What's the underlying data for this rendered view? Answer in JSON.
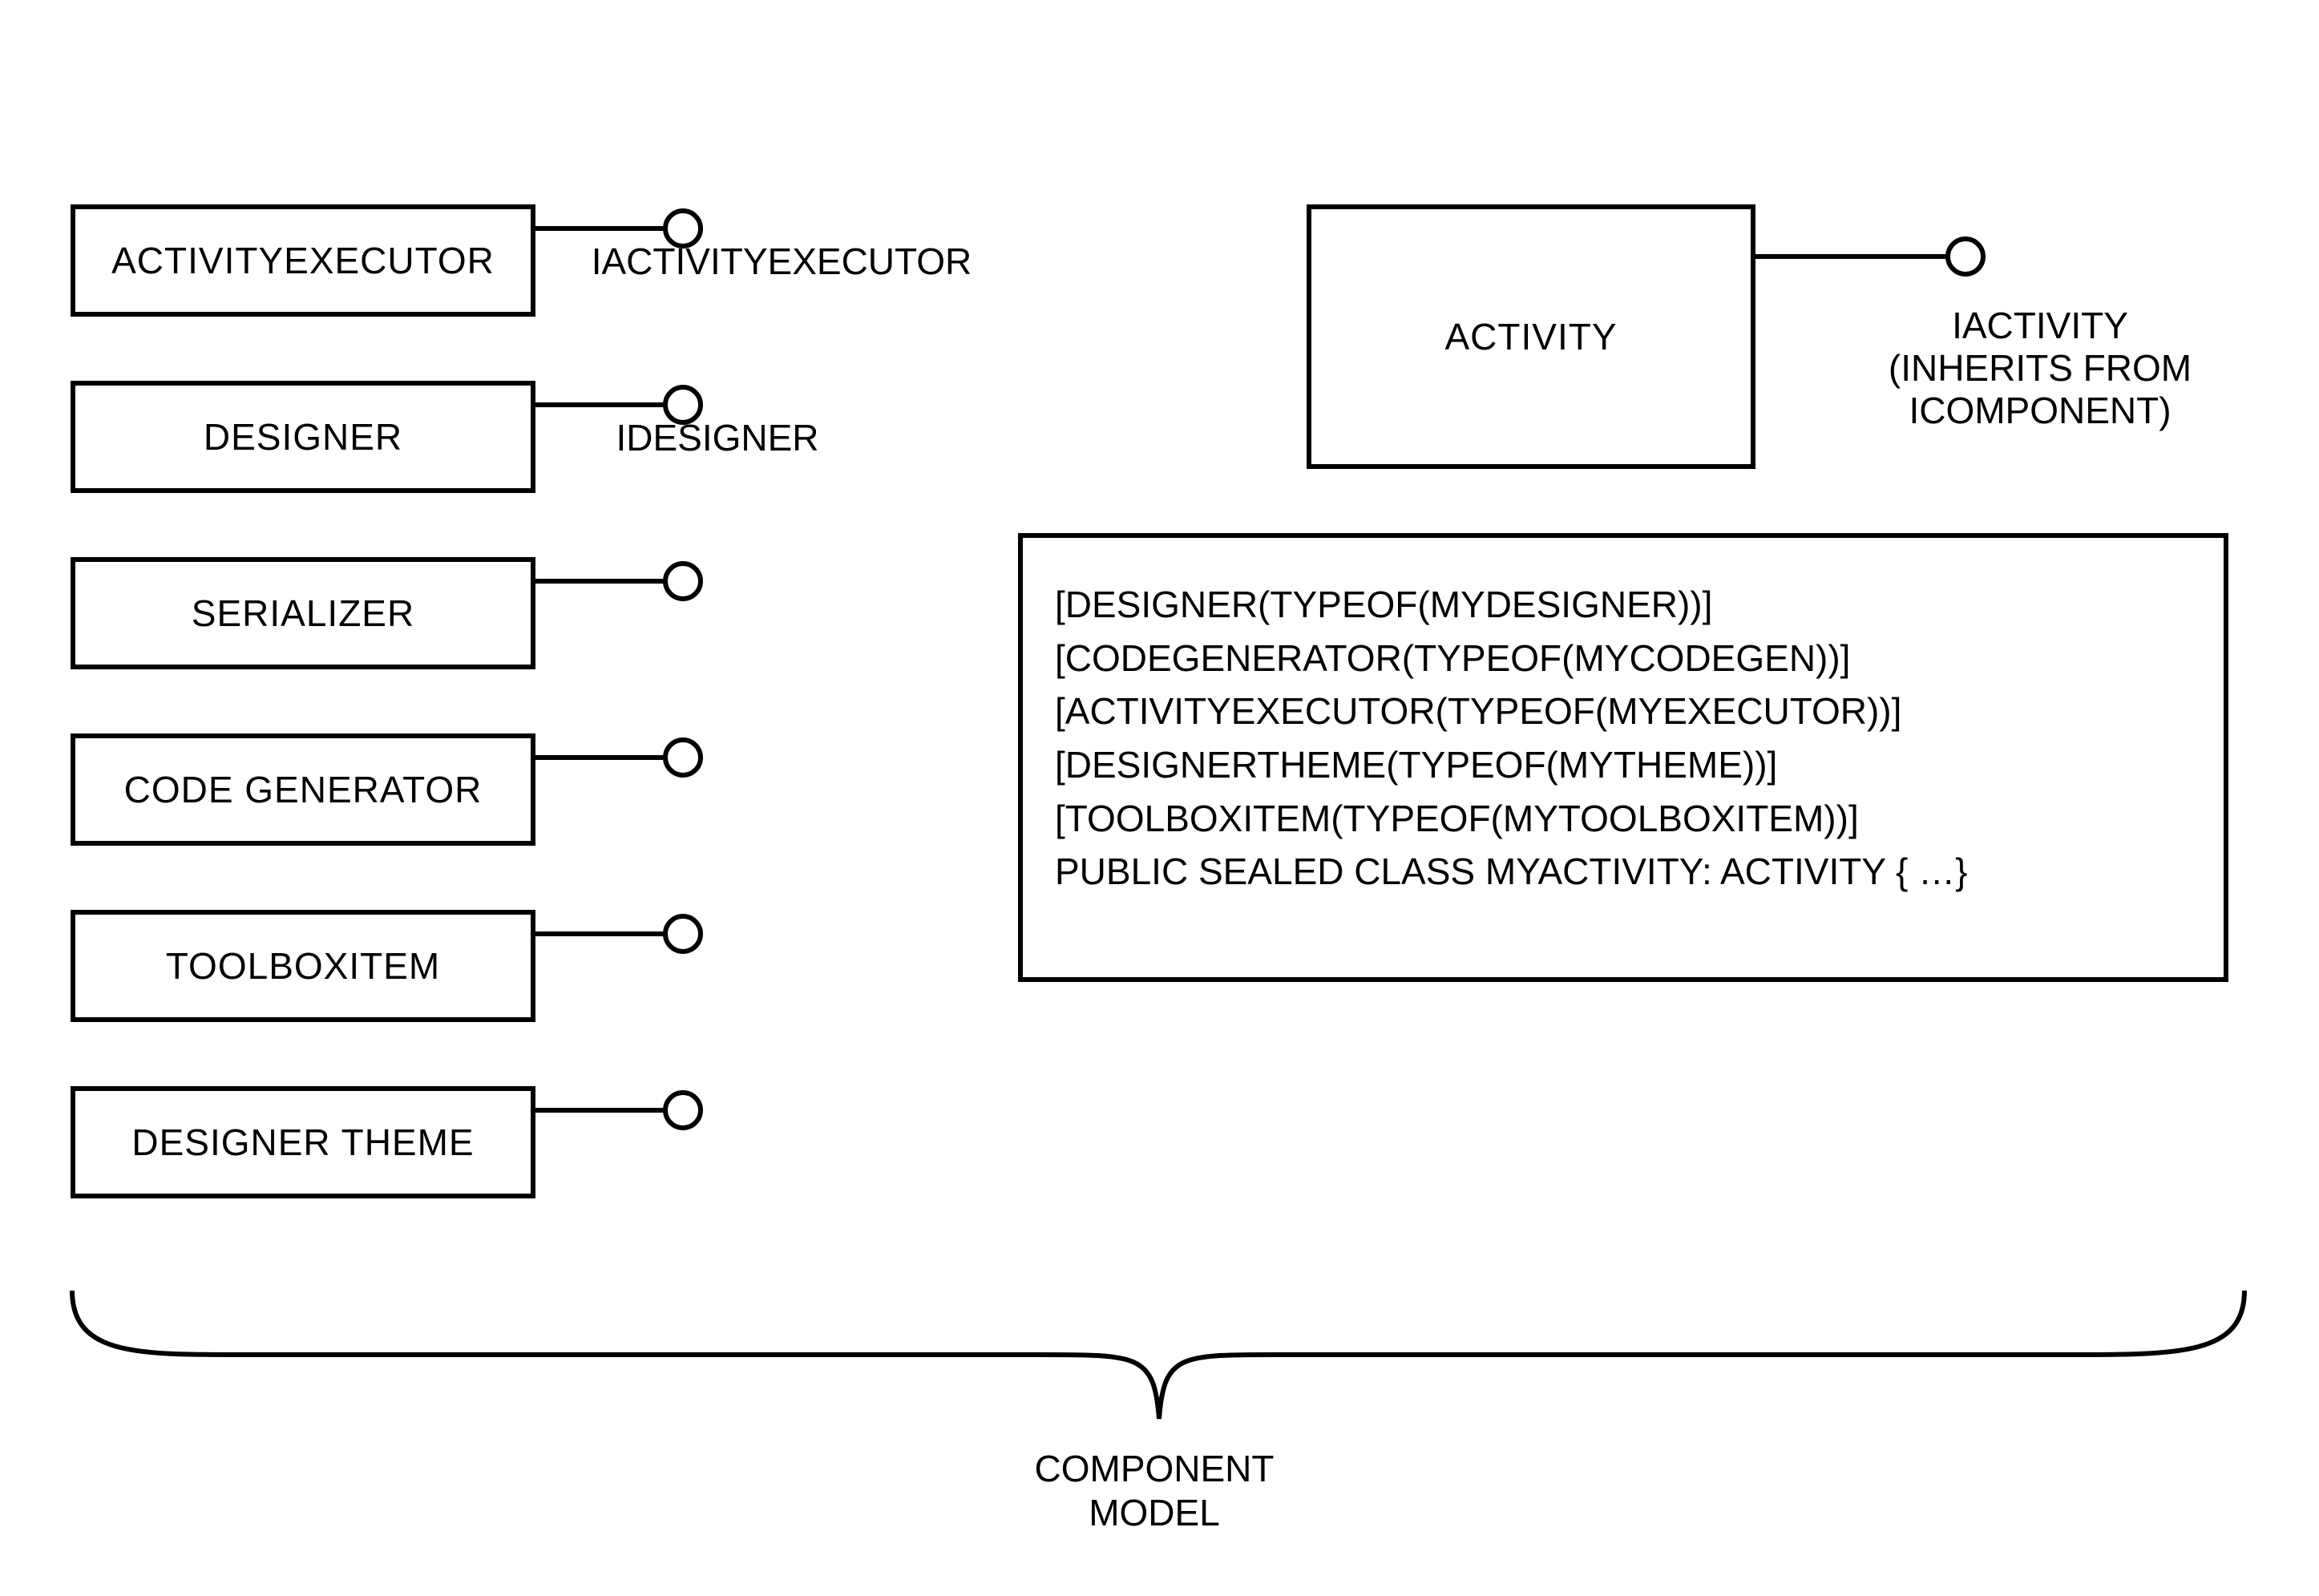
{
  "leftBoxes": [
    {
      "label": "ACTIVITYEXECUTOR",
      "iface": "IACTIVITYEXECUTOR"
    },
    {
      "label": "DESIGNER",
      "iface": "IDESIGNER"
    },
    {
      "label": "SERIALIZER",
      "iface": ""
    },
    {
      "label": "CODE GENERATOR",
      "iface": ""
    },
    {
      "label": "TOOLBOXITEM",
      "iface": ""
    },
    {
      "label": "DESIGNER THEME",
      "iface": ""
    }
  ],
  "activity": {
    "label": "ACTIVITY",
    "ifaceLine1": "IACTIVITY",
    "ifaceLine2": "(INHERITS FROM",
    "ifaceLine3": "ICOMPONENT)"
  },
  "code": [
    "[DESIGNER(TYPEOF(MYDESIGNER))]",
    "[CODEGENERATOR(TYPEOF(MYCODEGEN))]",
    "[ACTIVITYEXECUTOR(TYPEOF(MYEXECUTOR))]",
    "[DESIGNERTHEME(TYPEOF(MYTHEME))]",
    "[TOOLBOXITEM(TYPEOF(MYTOOLBOXITEM))]",
    "PUBLIC SEALED CLASS MYACTIVITY: ACTIVITY { …}"
  ],
  "caption": {
    "line1": "COMPONENT",
    "line2": "MODEL"
  }
}
